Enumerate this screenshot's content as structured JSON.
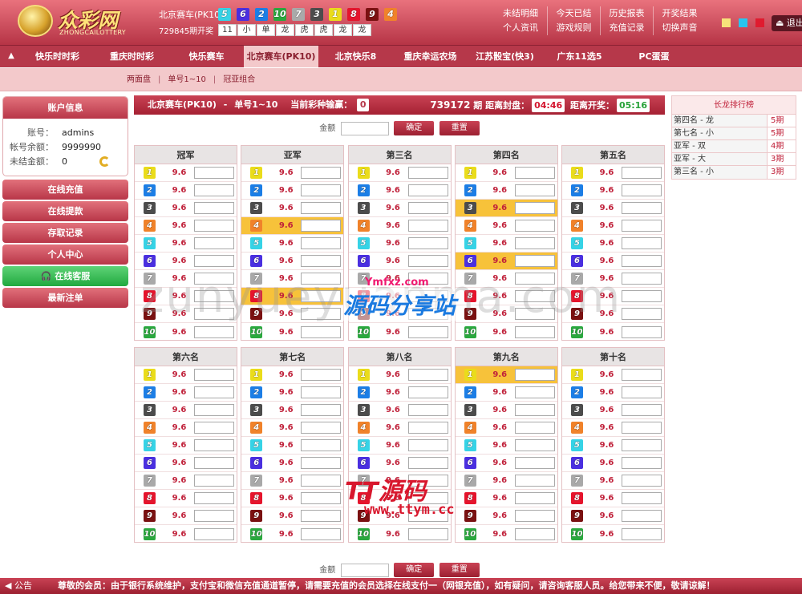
{
  "header": {
    "logo_name": "众彩网",
    "logo_sub": "ZHONGCAILOTTERY",
    "draw_title": "北京赛车(PK10)",
    "draw_period": "729845期开奖",
    "draw_balls": [
      5,
      6,
      2,
      10,
      7,
      3,
      1,
      8,
      9,
      4
    ],
    "draw_stats": [
      "11",
      "小",
      "单",
      "龙",
      "虎",
      "虎",
      "龙",
      "龙"
    ],
    "links": [
      "未结明细",
      "今天已结",
      "历史报表",
      "开奖结果",
      "个人资讯",
      "游戏规则",
      "充值记录",
      "切换声音"
    ],
    "swatch_colors": [
      "#f7e27a",
      "#28c5ef",
      "#e01b2f"
    ],
    "logout_label": "退出"
  },
  "ball_colors": {
    "1": "#eadc1b",
    "2": "#1c7ee6",
    "3": "#4c4c4c",
    "4": "#f0822a",
    "5": "#36d3e6",
    "6": "#4a2fe0",
    "7": "#a9a9a9",
    "8": "#e5142c",
    "9": "#7a1111",
    "10": "#2aa83e"
  },
  "nav": {
    "tabs": [
      "快乐时时彩",
      "重庆时时彩",
      "快乐赛车",
      "北京赛车(PK10)",
      "北京快乐8",
      "重庆幸运农场",
      "江苏骰宝(快3)",
      "广东11选5",
      "PC蛋蛋"
    ],
    "active_index": 3,
    "subnav": [
      "两面盘",
      "单号1~10",
      "冠亚组合"
    ]
  },
  "account": {
    "title": "账户信息",
    "rows": [
      {
        "label": "账号：",
        "value": "admins"
      },
      {
        "label": "帐号余额：",
        "value": "9999990"
      },
      {
        "label": "未结金额：",
        "value": "0"
      }
    ]
  },
  "side_buttons": [
    "在线充值",
    "在线提款",
    "存取记录",
    "个人中心",
    "在线客服",
    "最新注单"
  ],
  "betbar": {
    "game": "北京赛车(PK10)",
    "dash": "-",
    "mode": "单号1~10",
    "odd_label": "当前彩种输赢：",
    "odd_value": "0",
    "period_num": "739172",
    "period_suffix": "期",
    "close_label": "距离封盘：",
    "close_time": "04:46",
    "open_label": "距离开奖：",
    "open_time": "05:16"
  },
  "amount": {
    "label": "金额",
    "confirm": "确定",
    "reset": "重置"
  },
  "odds_value": "9.6",
  "positions": [
    {
      "name": "冠军",
      "highlight": []
    },
    {
      "name": "亚军",
      "highlight": [
        4,
        8
      ]
    },
    {
      "name": "第三名",
      "highlight": []
    },
    {
      "name": "第四名",
      "highlight": [
        3,
        6
      ]
    },
    {
      "name": "第五名",
      "highlight": []
    },
    {
      "name": "第六名",
      "highlight": []
    },
    {
      "name": "第七名",
      "highlight": []
    },
    {
      "name": "第八名",
      "highlight": []
    },
    {
      "name": "第九名",
      "highlight": [
        1
      ]
    },
    {
      "name": "第十名",
      "highlight": []
    }
  ],
  "dragon": {
    "title": "长龙排行榜",
    "rows": [
      {
        "name": "第四名 - 龙",
        "periods": "5期"
      },
      {
        "name": "第七名 - 小",
        "periods": "5期"
      },
      {
        "name": "亚军 - 双",
        "periods": "4期"
      },
      {
        "name": "亚军 - 大",
        "periods": "3期"
      },
      {
        "name": "第三名 - 小",
        "periods": "3期"
      }
    ]
  },
  "notice": {
    "label": "公告",
    "text": "尊敬的会员：由于银行系统维护，支付宝和微信充值通道暂停，请需要充值的会员选择在线支付一（网银充值），如有疑问，请咨询客服人员。给您带来不便，敬请谅解！"
  },
  "watermarks": {
    "big": "zunyueyuanma.com",
    "small": "Ymfxz.com",
    "brand": "源码分享站",
    "tt_title": "TT源码",
    "tt_url": "www.ttym.cc"
  }
}
